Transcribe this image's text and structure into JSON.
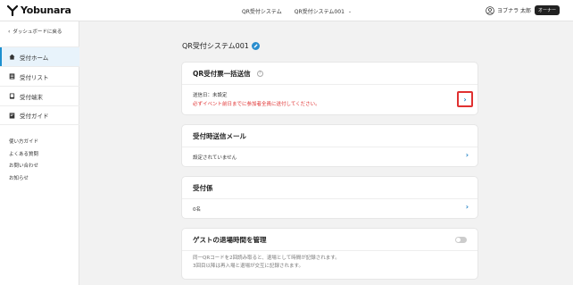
{
  "header": {
    "brand": "Yobunara",
    "system_label": "QR受付システム",
    "system_select": "QR受付システム001",
    "user_name": "ヨブナラ 太郎",
    "role_badge": "オーナー"
  },
  "sidebar": {
    "back_label": "ダッシュボードに戻る",
    "items": [
      {
        "label": "受付ホーム",
        "icon": "home-icon"
      },
      {
        "label": "受付リスト",
        "icon": "list-icon"
      },
      {
        "label": "受付端末",
        "icon": "device-icon"
      },
      {
        "label": "受付ガイド",
        "icon": "guide-icon"
      }
    ],
    "links": [
      "使い方ガイド",
      "よくある質問",
      "お問い合わせ",
      "お知らせ"
    ]
  },
  "main": {
    "title": "QR受付システム001",
    "cards": {
      "bulk_send": {
        "title": "QR受付票一括送信",
        "send_date": "送信日：未設定",
        "warning": "必ずイベント前日までに参加者全員に送付してください。"
      },
      "reception_mail": {
        "title": "受付時送信メール",
        "status": "設定されていません"
      },
      "staff": {
        "title": "受付係",
        "count": "0名"
      },
      "exit_time": {
        "title": "ゲストの退場時間を管理",
        "line1": "同一QRコードを2回読み取ると、退場として時間が記録されます。",
        "line2": "3回目以降は再入場と退場が交互に記録されます。",
        "toggle_on": false
      }
    }
  },
  "colors": {
    "accent": "#1c8fcf",
    "warning": "#e03131",
    "highlight_border": "#e03131"
  }
}
